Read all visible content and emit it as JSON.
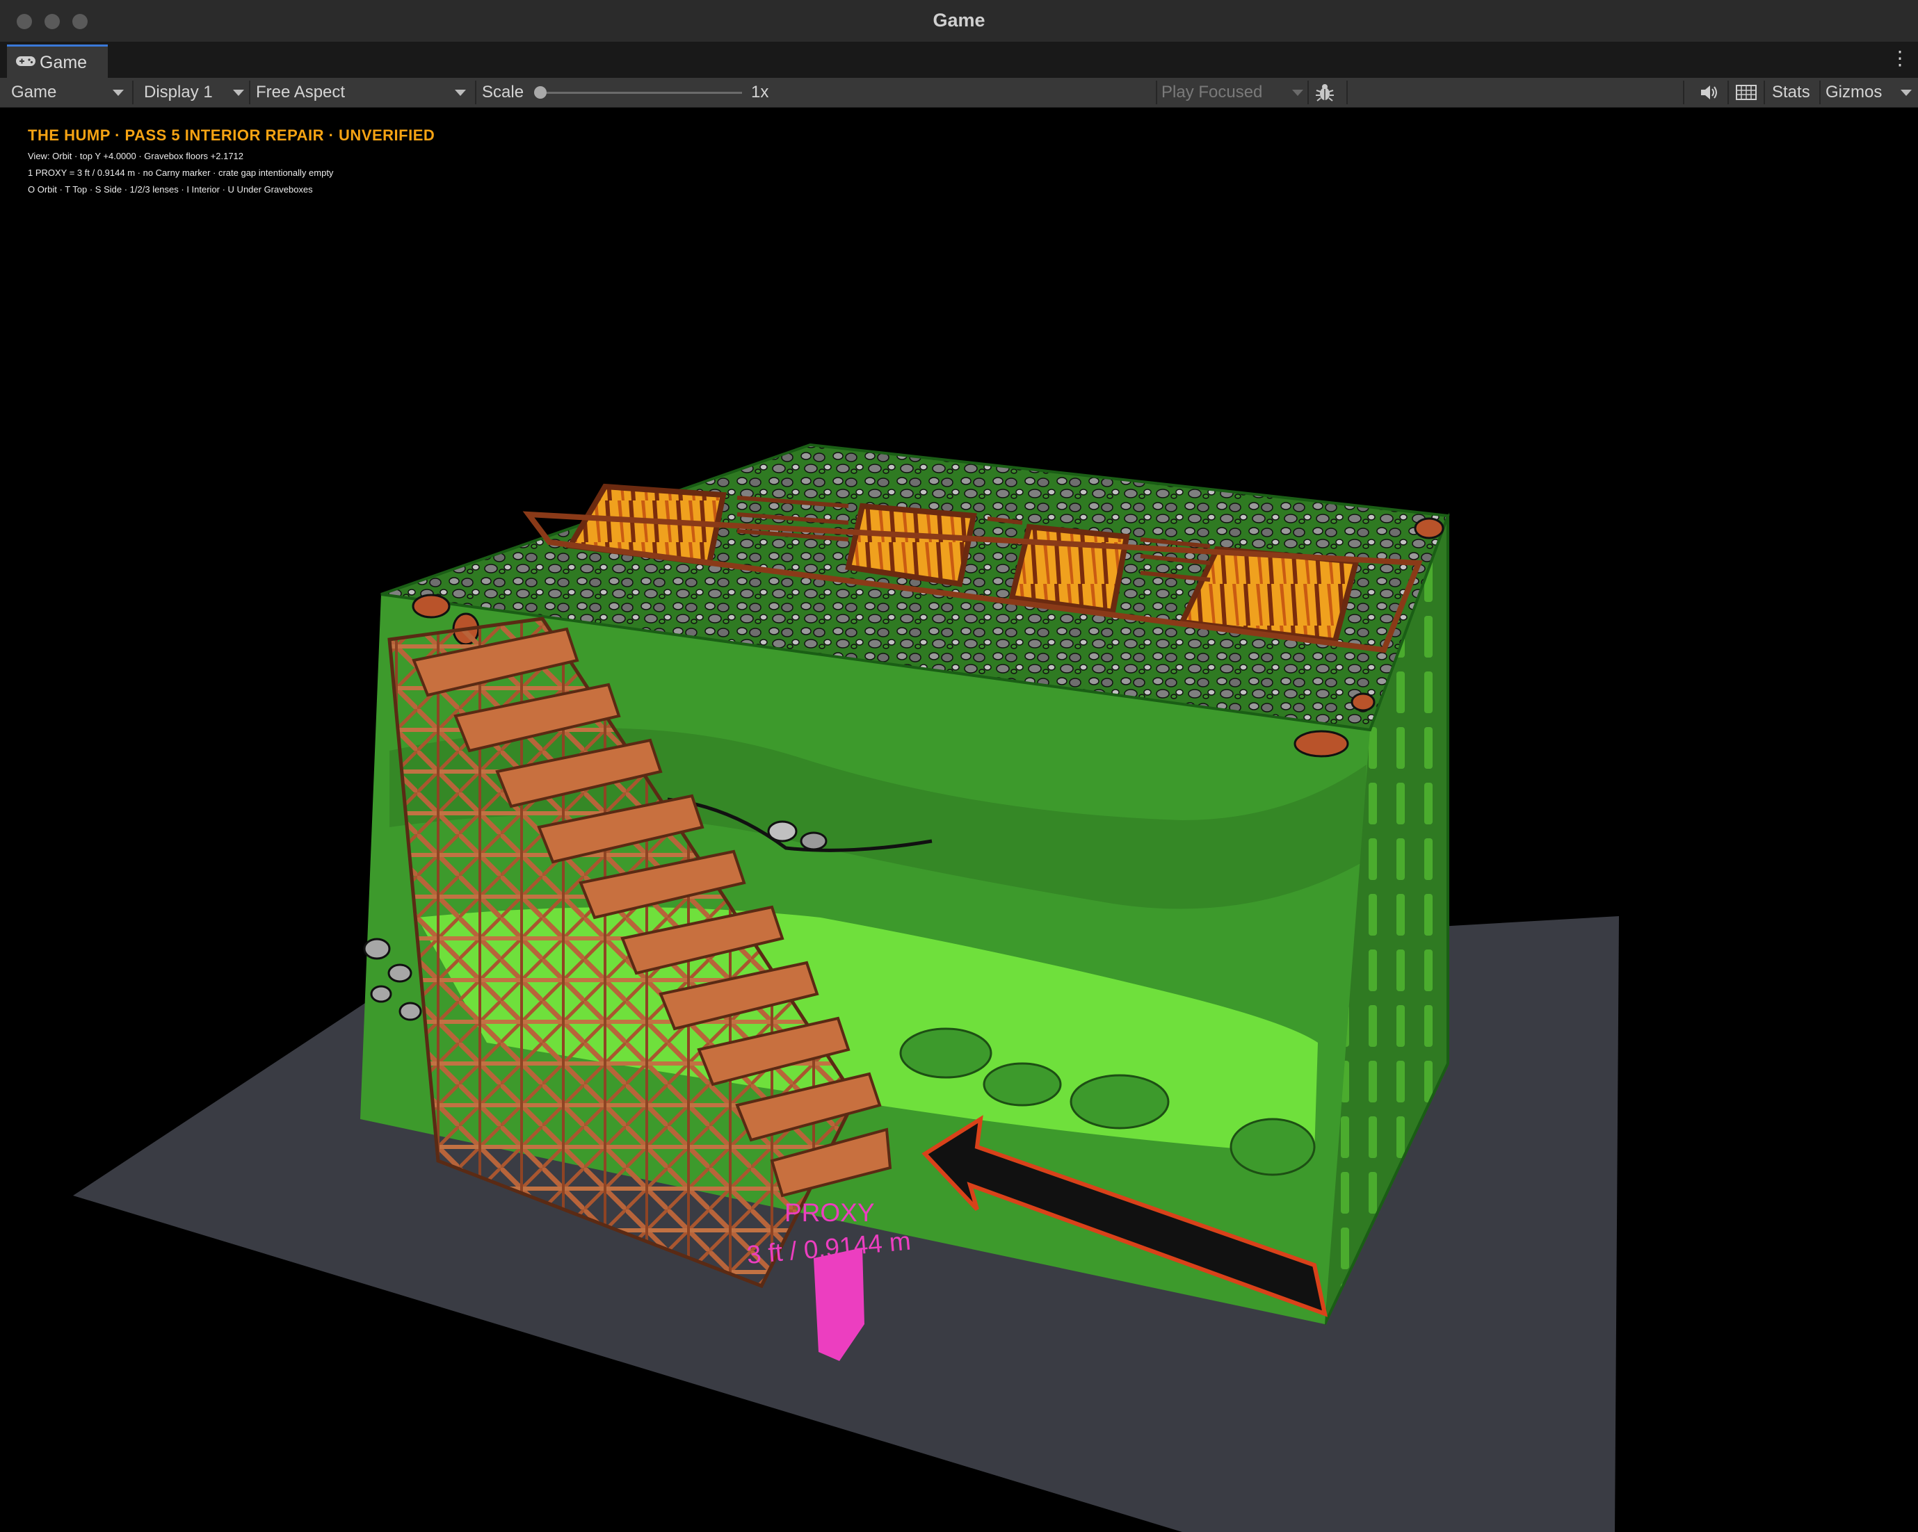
{
  "window": {
    "title": "Game"
  },
  "tab": {
    "label": "Game"
  },
  "toolbar": {
    "mode_label": "Game",
    "display_label": "Display 1",
    "aspect_label": "Free Aspect",
    "scale_label": "Scale",
    "scale_value": "1x",
    "play_mode_label": "Play Focused",
    "stats_label": "Stats",
    "gizmos_label": "Gizmos"
  },
  "hud": {
    "title": "THE HUMP · PASS 5 INTERIOR REPAIR · UNVERIFIED",
    "line1": "View: Orbit · top Y +4.0000 · Gravebox floors +2.1712",
    "line2": "1 PROXY = 3 ft / 0.9144 m · no Carny marker · crate gap intentionally empty",
    "line3": "O Orbit · T Top · S Side · 1/2/3 lenses · I Interior · U Under Graveboxes"
  },
  "scene": {
    "proxy_label": "PROXY",
    "proxy_size_label": "3 ft / 0.9144 m",
    "colors": {
      "ground": "#3a3c44",
      "grass_dark": "#3d9a2c",
      "grass_light": "#6fe03c",
      "wood": "#b8643a",
      "proxy": "#ec3ec0",
      "hud_title": "#f6a313"
    }
  }
}
